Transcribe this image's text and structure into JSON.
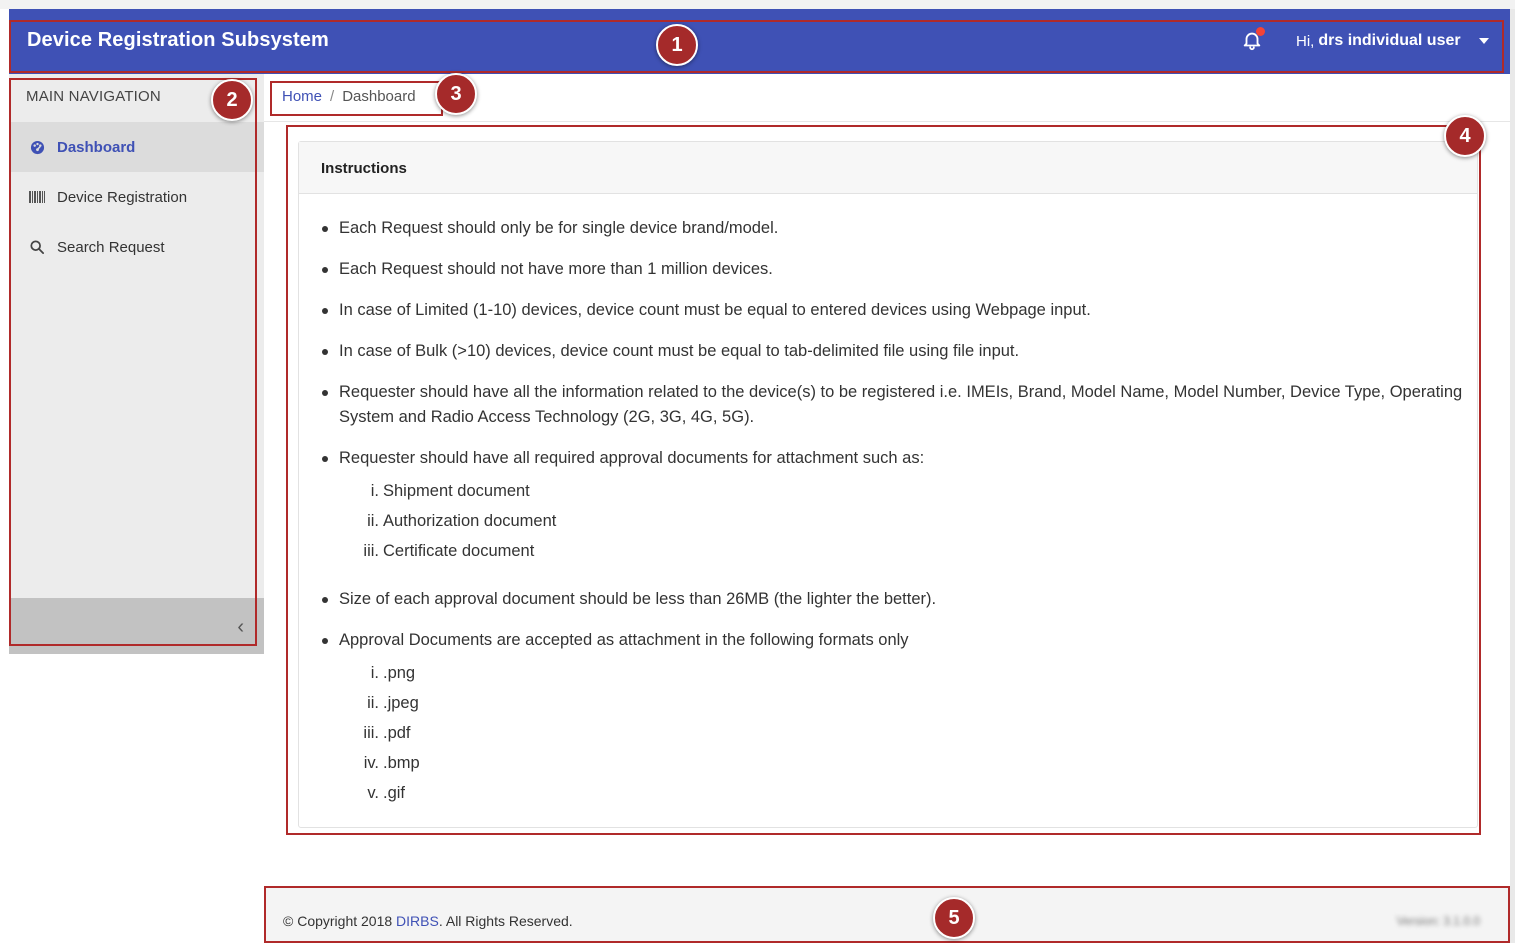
{
  "header": {
    "title": "Device Registration Subsystem",
    "greeting": "Hi,",
    "user_name": "drs individual user"
  },
  "sidebar": {
    "heading": "MAIN NAVIGATION",
    "items": [
      {
        "label": "Dashboard",
        "icon": "dashboard-icon",
        "active": true
      },
      {
        "label": "Device Registration",
        "icon": "barcode-icon",
        "active": false
      },
      {
        "label": "Search Request",
        "icon": "search-icon",
        "active": false
      }
    ]
  },
  "breadcrumb": {
    "home": "Home",
    "separator": "/",
    "current": "Dashboard"
  },
  "instructions": {
    "title": "Instructions",
    "items": [
      "Each Request should only be for single device brand/model.",
      "Each Request should not have more than 1 million devices.",
      "In case of Limited (1-10) devices, device count must be equal to entered devices using Webpage input.",
      "In case of Bulk (>10) devices, device count must be equal to tab-delimited file using file input.",
      "Requester should have all the information related to the device(s) to be registered i.e. IMEIs, Brand, Model Name, Model Number, Device Type, Operating System and Radio Access Technology (2G, 3G, 4G, 5G).",
      "Requester should have all required approval documents for attachment such as:",
      "Size of each approval document should be less than 26MB (the lighter the better).",
      "Approval Documents are accepted as attachment in the following formats only"
    ],
    "documents": [
      {
        "num": "i.",
        "text": "Shipment document"
      },
      {
        "num": "ii.",
        "text": "Authorization document"
      },
      {
        "num": "iii.",
        "text": "Certificate document"
      }
    ],
    "formats": [
      {
        "num": "i.",
        "text": ".png"
      },
      {
        "num": "ii.",
        "text": ".jpeg"
      },
      {
        "num": "iii.",
        "text": ".pdf"
      },
      {
        "num": "iv.",
        "text": ".bmp"
      },
      {
        "num": "v.",
        "text": ".gif"
      }
    ]
  },
  "footer": {
    "copyright_prefix": "© Copyright 2018 ",
    "org": "DIRBS",
    "copyright_suffix": ". All Rights Reserved.",
    "version": "Version: 3.1.0.0"
  },
  "annotations": [
    "1",
    "2",
    "3",
    "4",
    "5"
  ],
  "colors": {
    "header_bg": "#3f51b5",
    "accent": "#3f51b5",
    "annotation": "#a52a2a",
    "notification_dot": "#f44336"
  }
}
